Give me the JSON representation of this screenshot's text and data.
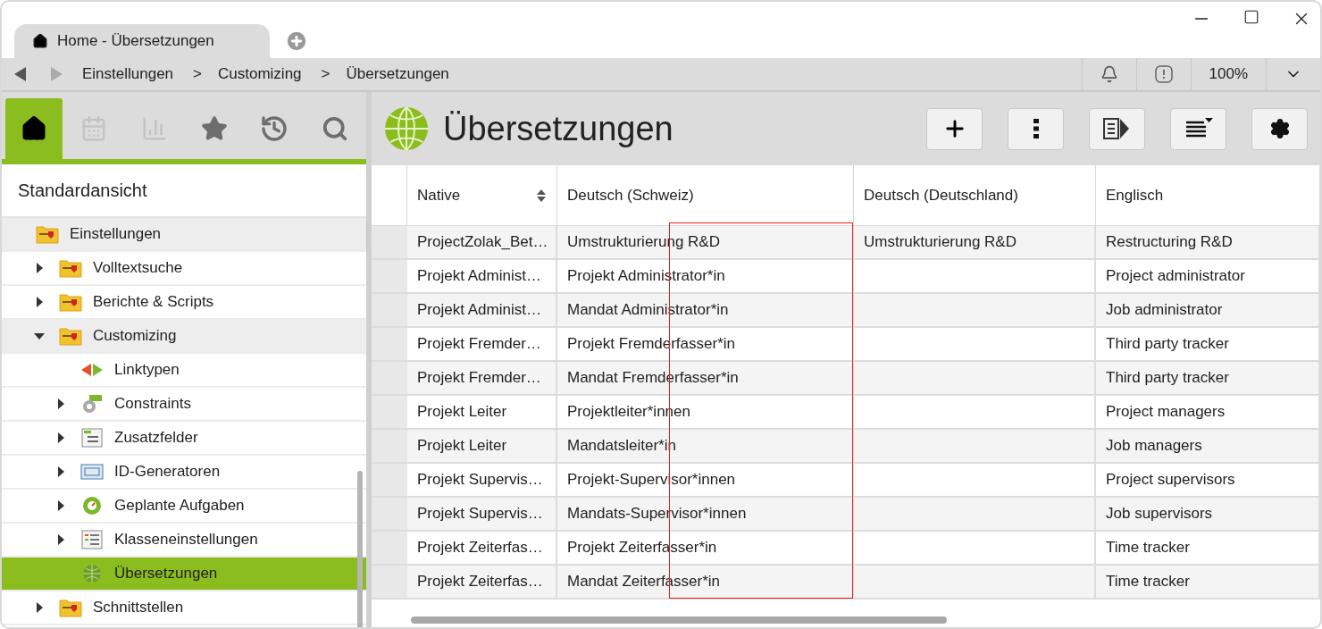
{
  "tab": {
    "title": "Home - Übersetzungen"
  },
  "breadcrumb": [
    "Einstellungen",
    "Customizing",
    "Übersetzungen"
  ],
  "separator": ">",
  "zoom": "100%",
  "sidebar_tabs": [
    {
      "kind": "home",
      "selected": true,
      "disabled": false
    },
    {
      "kind": "calendar",
      "selected": false,
      "disabled": true
    },
    {
      "kind": "chart",
      "selected": false,
      "disabled": true
    },
    {
      "kind": "star",
      "selected": false,
      "disabled": false
    },
    {
      "kind": "history",
      "selected": false,
      "disabled": false
    },
    {
      "kind": "search",
      "selected": false,
      "disabled": false
    }
  ],
  "view_title": "Standardansicht",
  "tree": {
    "label": "Einstellungen",
    "kind": "folder",
    "children": [
      {
        "label": "Volltextsuche",
        "kind": "folder",
        "expanded": false,
        "selected": false
      },
      {
        "label": "Berichte & Scripts",
        "kind": "folder",
        "expanded": false,
        "selected": false
      },
      {
        "label": "Customizing",
        "kind": "folder",
        "expanded": true,
        "selected": false,
        "highlighted": true,
        "children": [
          {
            "label": "Linktypen",
            "kind": "link",
            "selected": false
          },
          {
            "label": "Constraints",
            "kind": "constraint",
            "expanded": false,
            "selected": false
          },
          {
            "label": "Zusatzfelder",
            "kind": "fields",
            "expanded": false,
            "selected": false
          },
          {
            "label": "ID-Generatoren",
            "kind": "id",
            "expanded": false,
            "selected": false
          },
          {
            "label": "Geplante Aufgaben",
            "kind": "tasks",
            "expanded": false,
            "selected": false
          },
          {
            "label": "Klasseneinstellungen",
            "kind": "classes",
            "expanded": false,
            "selected": false
          },
          {
            "label": "Übersetzungen",
            "kind": "globe",
            "selected": true
          }
        ]
      },
      {
        "label": "Schnittstellen",
        "kind": "folder",
        "expanded": false,
        "selected": false
      }
    ]
  },
  "page_title": "Übersetzungen",
  "toolbar": [
    {
      "kind": "add"
    },
    {
      "kind": "more"
    },
    {
      "kind": "panel"
    },
    {
      "kind": "list"
    },
    {
      "kind": "settings"
    }
  ],
  "table": {
    "columns": [
      {
        "label": "Native",
        "sortable": true
      },
      {
        "label": "Deutsch (Schweiz)",
        "sortable": false
      },
      {
        "label": "Deutsch (Deutschland)",
        "sortable": false
      },
      {
        "label": "Englisch",
        "sortable": false
      }
    ],
    "rows": [
      [
        "ProjectZolak_Bet…",
        "Umstrukturierung R&D",
        "Umstrukturierung R&D",
        "Restructuring R&D"
      ],
      [
        "Projekt Administ…",
        "Projekt Administrator*in",
        "",
        "Project administrator"
      ],
      [
        "Projekt Administ…",
        "Mandat Administrator*in",
        "",
        "Job administrator"
      ],
      [
        "Projekt Fremder…",
        "Projekt Fremderfasser*in",
        "",
        "Third party tracker"
      ],
      [
        "Projekt Fremder…",
        "Mandat Fremderfasser*in",
        "",
        "Third party tracker"
      ],
      [
        "Projekt Leiter",
        "Projektleiter*innen",
        "",
        "Project managers"
      ],
      [
        "Projekt Leiter",
        "Mandatsleiter*in",
        "",
        "Job managers"
      ],
      [
        "Projekt Supervis…",
        "Projekt-Supervisor*innen",
        "",
        "Project supervisors"
      ],
      [
        "Projekt Supervis…",
        "Mandats-Supervisor*innen",
        "",
        "Job supervisors"
      ],
      [
        "Projekt Zeiterfas…",
        "Projekt Zeiterfasser*in",
        "",
        "Time tracker"
      ],
      [
        "Projekt Zeiterfas…",
        "Mandat Zeiterfasser*in",
        "",
        "Time tracker"
      ]
    ]
  }
}
